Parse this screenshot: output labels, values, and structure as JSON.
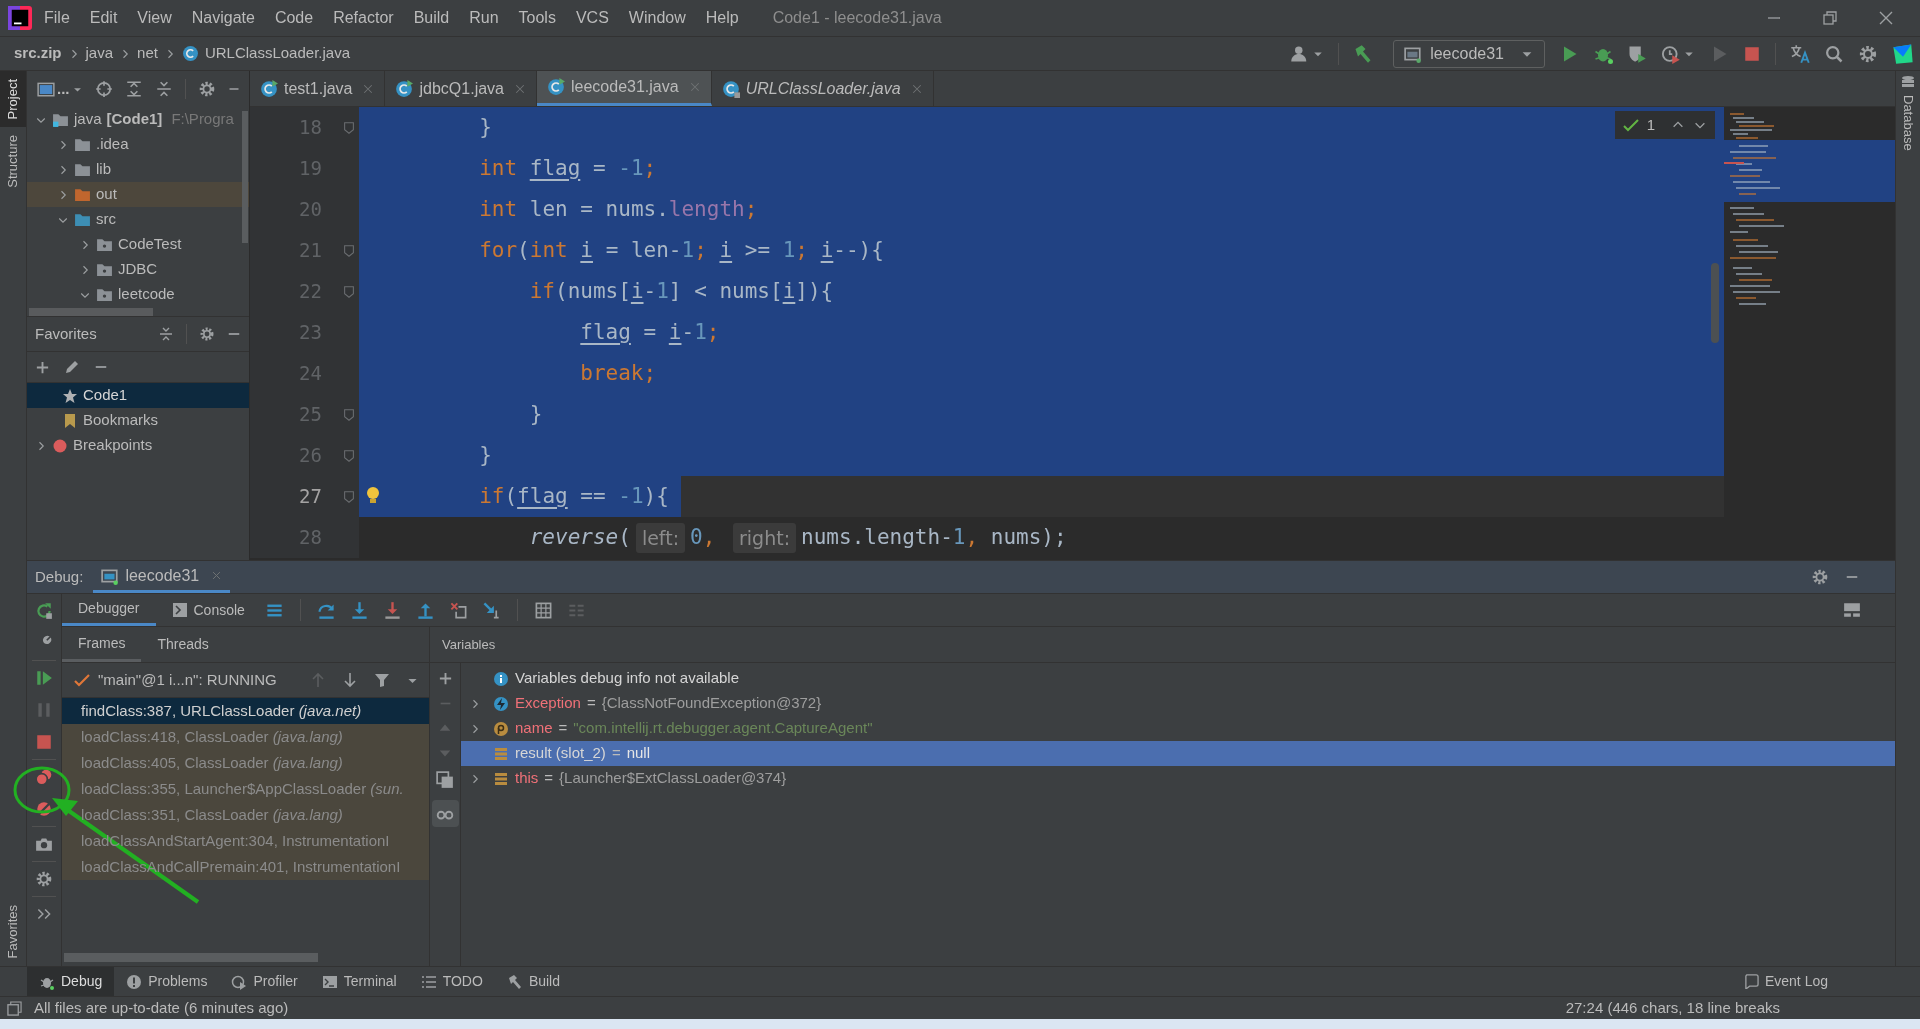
{
  "menu_bar": {
    "items": [
      "File",
      "Edit",
      "View",
      "Navigate",
      "Code",
      "Refactor",
      "Build",
      "Run",
      "Tools",
      "VCS",
      "Window",
      "Help"
    ],
    "title": "Code1 - leecode31.java"
  },
  "breadcrumb": [
    "src.zip",
    "java",
    "net",
    "URLClassLoader.java"
  ],
  "run_toolbar": {
    "configuration": "leecode31"
  },
  "left_tool_windows": [
    {
      "label": "Project",
      "selected": true
    },
    {
      "label": "Structure",
      "selected": false
    }
  ],
  "left_bottom_tool_windows": [
    {
      "label": "Favorites",
      "selected": false
    }
  ],
  "right_tool_windows": [
    "Database"
  ],
  "project_panel": {
    "view_selector": "...",
    "tree": [
      {
        "label": "java",
        "module": "[Code1]",
        "path": "F:\\Progra",
        "kind": "module",
        "expanded": true,
        "highlighted": false,
        "children": [
          {
            "label": ".idea",
            "kind": "plain",
            "expanded": false,
            "highlighted": false
          },
          {
            "label": "lib",
            "kind": "plain",
            "expanded": false,
            "highlighted": false
          },
          {
            "label": "out",
            "kind": "excluded",
            "expanded": false,
            "highlighted": true
          },
          {
            "label": "src",
            "kind": "source",
            "expanded": true,
            "highlighted": false,
            "children": [
              {
                "label": "CodeTest",
                "kind": "package",
                "expanded": false,
                "highlighted": false
              },
              {
                "label": "JDBC",
                "kind": "package",
                "expanded": false,
                "highlighted": false
              },
              {
                "label": "leetcode",
                "kind": "package",
                "expanded": true,
                "highlighted": false
              }
            ]
          }
        ]
      }
    ]
  },
  "favorites": {
    "title": "Favorites",
    "items": [
      {
        "label": "Code1",
        "kind": "star",
        "expandable": false,
        "selected": true
      },
      {
        "label": "Bookmarks",
        "kind": "bookmark",
        "expandable": false,
        "selected": false
      },
      {
        "label": "Breakpoints",
        "kind": "breakpoint",
        "expandable": true,
        "selected": false
      }
    ]
  },
  "editor": {
    "tabs": [
      {
        "label": "test1.java",
        "kind": "runnable",
        "selected": false
      },
      {
        "label": "jdbcQ1.java",
        "kind": "runnable",
        "selected": false
      },
      {
        "label": "leecode31.java",
        "kind": "runnable",
        "selected": true
      },
      {
        "label": "URLClassLoader.java",
        "kind": "library",
        "selected": false
      }
    ],
    "inspection_count": "1",
    "lines": [
      {
        "number": "18",
        "kind": "selected",
        "fold": true,
        "current": false,
        "bulb": false,
        "tokens": [
          {
            "t": "        }",
            "kind": "plain"
          }
        ]
      },
      {
        "number": "19",
        "kind": "selected",
        "fold": false,
        "current": false,
        "bulb": false,
        "tokens": [
          {
            "t": "        int ",
            "kind": "kw"
          },
          {
            "t": "flag",
            "kind": "var"
          },
          {
            "t": " = ",
            "kind": "plain"
          },
          {
            "t": "-1",
            "kind": "num"
          },
          {
            "t": ";",
            "kind": "kw"
          }
        ]
      },
      {
        "number": "20",
        "kind": "selected",
        "fold": false,
        "current": false,
        "bulb": false,
        "tokens": [
          {
            "t": "        int ",
            "kind": "kw"
          },
          {
            "t": "len = nums.",
            "kind": "plain"
          },
          {
            "t": "length",
            "kind": "field"
          },
          {
            "t": ";",
            "kind": "kw"
          }
        ]
      },
      {
        "number": "21",
        "kind": "selected",
        "fold": true,
        "current": false,
        "bulb": false,
        "tokens": [
          {
            "t": "        for",
            "kind": "kw"
          },
          {
            "t": "(",
            "kind": "plain"
          },
          {
            "t": "int ",
            "kind": "kw"
          },
          {
            "t": "i",
            "kind": "var"
          },
          {
            "t": " = len-",
            "kind": "plain"
          },
          {
            "t": "1",
            "kind": "num"
          },
          {
            "t": "; ",
            "kind": "kw"
          },
          {
            "t": "i",
            "kind": "var"
          },
          {
            "t": " >= ",
            "kind": "plain"
          },
          {
            "t": "1",
            "kind": "num"
          },
          {
            "t": "; ",
            "kind": "kw"
          },
          {
            "t": "i",
            "kind": "var"
          },
          {
            "t": "--){",
            "kind": "plain"
          }
        ]
      },
      {
        "number": "22",
        "kind": "selected",
        "fold": true,
        "current": false,
        "bulb": false,
        "tokens": [
          {
            "t": "            if",
            "kind": "kw"
          },
          {
            "t": "(nums[",
            "kind": "plain"
          },
          {
            "t": "i",
            "kind": "var"
          },
          {
            "t": "-",
            "kind": "plain"
          },
          {
            "t": "1",
            "kind": "num"
          },
          {
            "t": "] < nums[",
            "kind": "plain"
          },
          {
            "t": "i",
            "kind": "var"
          },
          {
            "t": "]){",
            "kind": "plain"
          }
        ]
      },
      {
        "number": "23",
        "kind": "selected",
        "fold": false,
        "current": false,
        "bulb": false,
        "tokens": [
          {
            "t": "                flag",
            "kind": "var"
          },
          {
            "t": " = ",
            "kind": "plain"
          },
          {
            "t": "i",
            "kind": "var"
          },
          {
            "t": "-",
            "kind": "plain"
          },
          {
            "t": "1",
            "kind": "num"
          },
          {
            "t": ";",
            "kind": "kw"
          }
        ]
      },
      {
        "number": "24",
        "kind": "selected",
        "fold": false,
        "current": false,
        "bulb": false,
        "tokens": [
          {
            "t": "                break;",
            "kind": "kw"
          }
        ]
      },
      {
        "number": "25",
        "kind": "selected",
        "fold": true,
        "current": false,
        "bulb": false,
        "tokens": [
          {
            "t": "            }",
            "kind": "plain"
          }
        ]
      },
      {
        "number": "26",
        "kind": "selected",
        "fold": true,
        "current": false,
        "bulb": false,
        "tokens": [
          {
            "t": "        }",
            "kind": "plain"
          }
        ]
      },
      {
        "number": "27",
        "kind": "selected_text",
        "fold": true,
        "current": true,
        "bulb": true,
        "tokens": [
          {
            "t": "        if",
            "kind": "kw"
          },
          {
            "t": "(",
            "kind": "plain"
          },
          {
            "t": "flag",
            "kind": "var"
          },
          {
            "t": " == ",
            "kind": "plain"
          },
          {
            "t": "-1",
            "kind": "num"
          },
          {
            "t": "){",
            "kind": "plain"
          }
        ]
      },
      {
        "number": "28",
        "kind": "plain",
        "fold": false,
        "current": false,
        "bulb": false,
        "tokens": [
          {
            "t": "            reverse",
            "kind": "call"
          },
          {
            "t": "(",
            "kind": "plain"
          },
          {
            "t": "left:",
            "kind": "hint"
          },
          {
            "t": "0",
            "kind": "num"
          },
          {
            "t": ", ",
            "kind": "kw"
          },
          {
            "t": "right:",
            "kind": "hint"
          },
          {
            "t": "nums.length-",
            "kind": "plain"
          },
          {
            "t": "1",
            "kind": "num"
          },
          {
            "t": ", ",
            "kind": "kw"
          },
          {
            "t": "nums);",
            "kind": "plain"
          }
        ]
      }
    ]
  },
  "debug": {
    "title": "Debug:",
    "session_tab": "leecode31",
    "tabs": [
      {
        "label": "Debugger",
        "selected": true
      },
      {
        "label": "Console",
        "selected": false
      }
    ],
    "frame_tabs": [
      {
        "label": "Frames",
        "selected": true
      },
      {
        "label": "Threads",
        "selected": false
      }
    ],
    "thread": "\"main\"@1 i...n\": RUNNING",
    "frames": [
      {
        "text": "findClass:387, URLClassLoader *(java.net)*",
        "selected": true,
        "library": false
      },
      {
        "text": "loadClass:418, ClassLoader *(java.lang)*",
        "selected": false,
        "library": true
      },
      {
        "text": "loadClass:405, ClassLoader *(java.lang)*",
        "selected": false,
        "library": true
      },
      {
        "text": "loadClass:355, Launcher$AppClassLoader *(sun.*",
        "selected": false,
        "library": true
      },
      {
        "text": "loadClass:351, ClassLoader *(java.lang)*",
        "selected": false,
        "library": true
      },
      {
        "text": "loadClassAndStartAgent:304, InstrumentationI",
        "selected": false,
        "library": true
      },
      {
        "text": "loadClassAndCallPremain:401, InstrumentationI",
        "selected": false,
        "library": true
      }
    ],
    "variables_title": "Variables",
    "variables": [
      {
        "kind": "info",
        "name": "Variables debug info not available",
        "expandable": false,
        "selected": false
      },
      {
        "kind": "exception",
        "name": "Exception",
        "operator": "=",
        "value": "{ClassNotFoundException@372}",
        "expandable": true,
        "selected": false
      },
      {
        "kind": "param",
        "name": "name",
        "operator": "=",
        "value": "\"com.intellij.rt.debugger.agent.CaptureAgent\"",
        "expandable": true,
        "selected": false
      },
      {
        "kind": "local",
        "name": "result (slot_2)",
        "operator": "=",
        "value": "null",
        "expandable": false,
        "selected": true
      },
      {
        "kind": "local",
        "name": "this",
        "operator": "=",
        "value": "{Launcher$ExtClassLoader@374}",
        "expandable": true,
        "selected": false
      }
    ]
  },
  "bottom_tabs": [
    {
      "label": "Debug",
      "kind": "debug",
      "selected": true
    },
    {
      "label": "Problems",
      "kind": "problems",
      "selected": false
    },
    {
      "label": "Profiler",
      "kind": "profiler",
      "selected": false
    },
    {
      "label": "Terminal",
      "kind": "terminal",
      "selected": false
    },
    {
      "label": "TODO",
      "kind": "todo",
      "selected": false
    },
    {
      "label": "Build",
      "kind": "build",
      "selected": false
    }
  ],
  "event_log": "Event Log",
  "taskbar": {
    "visible": true
  },
  "status_bar": {
    "message": "All files are up-to-date (6 minutes ago)",
    "position": "27:24 (446 chars, 18 line breaks"
  }
}
